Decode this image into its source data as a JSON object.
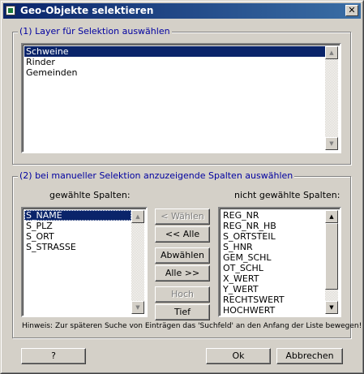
{
  "window": {
    "title": "Geo-Objekte selektieren",
    "close_glyph": "✕"
  },
  "group1": {
    "label": "(1) Layer für Selektion auswählen",
    "items": [
      "Schweine",
      "Rinder",
      "Gemeinden"
    ]
  },
  "group2": {
    "label": "(2) bei manueller Selektion anzuzeigende Spalten auswählen",
    "selected_header": "gewählte Spalten:",
    "unselected_header": "nicht gewählte Spalten:",
    "selected_items": [
      "S_NAME",
      "S_PLZ",
      "S_ORT",
      "S_STRASSE"
    ],
    "unselected_items": [
      "REG_NR",
      "REG_NR_HB",
      "S_ORTSTEIL",
      "S_HNR",
      "GEM_SCHL",
      "OT_SCHL",
      "X_WERT",
      "Y_WERT",
      "RECHTSWERT",
      "HOCHWERT"
    ],
    "buttons": {
      "select": "< Wählen",
      "select_all": "<< Alle",
      "deselect": "Abwählen >",
      "deselect_all": "Alle >>",
      "up": "Hoch",
      "down": "Tief"
    },
    "hint": "Hinweis: Zur späteren Suche von Einträgen das 'Suchfeld' an den Anfang der Liste bewegen!"
  },
  "footer": {
    "help": "?",
    "ok": "Ok",
    "cancel": "Abbrechen"
  },
  "scroll": {
    "up": "▲",
    "down": "▼"
  }
}
